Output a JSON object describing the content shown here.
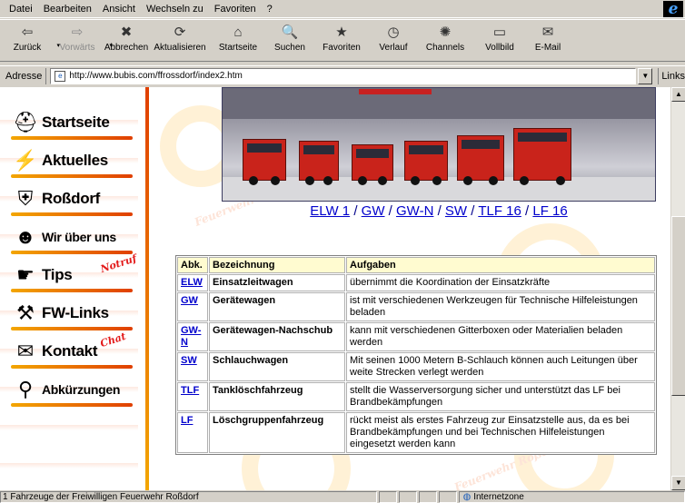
{
  "menu": [
    "Datei",
    "Bearbeiten",
    "Ansicht",
    "Wechseln zu",
    "Favoriten",
    "?"
  ],
  "toolbar": [
    {
      "label": "Zurück",
      "icon": "back-arrow-icon",
      "glyph": "⇦",
      "enabled": true,
      "dropdown": true
    },
    {
      "label": "Vorwärts",
      "icon": "forward-arrow-icon",
      "glyph": "⇨",
      "enabled": false,
      "dropdown": true
    },
    {
      "label": "Abbrechen",
      "icon": "stop-icon",
      "glyph": "✖",
      "enabled": true,
      "dropdown": false
    },
    {
      "label": "Aktualisieren",
      "icon": "refresh-icon",
      "glyph": "⟳",
      "enabled": true,
      "dropdown": false
    },
    {
      "label": "Startseite",
      "icon": "home-icon",
      "glyph": "⌂",
      "enabled": true,
      "dropdown": false
    },
    {
      "label": "Suchen",
      "icon": "search-icon",
      "glyph": "🔍",
      "enabled": true,
      "dropdown": false
    },
    {
      "label": "Favoriten",
      "icon": "favorites-icon",
      "glyph": "★",
      "enabled": true,
      "dropdown": false
    },
    {
      "label": "Verlauf",
      "icon": "history-icon",
      "glyph": "◷",
      "enabled": true,
      "dropdown": false
    },
    {
      "label": "Channels",
      "icon": "channels-icon",
      "glyph": "✺",
      "enabled": true,
      "dropdown": false
    },
    {
      "label": "Vollbild",
      "icon": "fullscreen-icon",
      "glyph": "▭",
      "enabled": true,
      "dropdown": false
    },
    {
      "label": "E-Mail",
      "icon": "mail-icon",
      "glyph": "✉",
      "enabled": true,
      "dropdown": false
    }
  ],
  "address": {
    "label": "Adresse",
    "url": "http://www.bubis.com/ffrossdorf/index2.htm",
    "links_label": "Links"
  },
  "nav": [
    {
      "label": "Startseite",
      "icon": "fire-brigade-emblem-icon",
      "glyph": "⛑",
      "badge": ""
    },
    {
      "label": "Aktuelles",
      "icon": "lightning-icon",
      "glyph": "⚡",
      "badge": ""
    },
    {
      "label": "Roßdorf",
      "icon": "coat-of-arms-icon",
      "glyph": "⛨",
      "badge": ""
    },
    {
      "label": "Wir über uns",
      "icon": "firefighters-icon",
      "glyph": "☻",
      "badge": ""
    },
    {
      "label": "Tips",
      "icon": "hand-pointing-icon",
      "glyph": "☛",
      "badge": "Notruf"
    },
    {
      "label": "FW-Links",
      "icon": "hose-nozzle-icon",
      "glyph": "⚒",
      "badge": ""
    },
    {
      "label": "Kontakt",
      "icon": "envelope-icon",
      "glyph": "✉",
      "badge": "Chat"
    },
    {
      "label": "Abkürzungen",
      "icon": "binoculars-icon",
      "glyph": "⚲",
      "badge": ""
    }
  ],
  "vehicle_links": [
    "ELW 1",
    "GW",
    "GW-N",
    "SW",
    "TLF 16",
    "LF 16"
  ],
  "table": {
    "headers": [
      "Abk.",
      "Bezeichnung",
      "Aufgaben"
    ],
    "rows": [
      {
        "abk": "ELW",
        "name": "Einsatzleitwagen",
        "task": "übernimmt die Koordination der Einsatzkräfte"
      },
      {
        "abk": "GW",
        "name": "Gerätewagen",
        "task": "ist mit verschiedenen Werkzeugen für Technische Hilfeleistungen beladen"
      },
      {
        "abk": "GW-N",
        "name": "Gerätewagen-Nachschub",
        "task": "kann mit verschiedenen Gitterboxen oder Materialien beladen werden"
      },
      {
        "abk": "SW",
        "name": "Schlauchwagen",
        "task": "Mit seinen 1000 Metern B-Schlauch können auch Leitungen über weite Strecken verlegt werden"
      },
      {
        "abk": "TLF",
        "name": "Tanklöschfahrzeug",
        "task": "stellt die Wasserversorgung sicher und unterstützt das LF bei Brandbekämpfungen"
      },
      {
        "abk": "LF",
        "name": "Löschgruppenfahrzeug",
        "task": "rückt meist als erstes Fahrzeug zur Einsatzstelle aus, da es bei Brandbekämpfungen und bei Technischen Hilfeleistungen eingesetzt werden kann"
      }
    ]
  },
  "watermark_text": "Feuerwehr Roßdorf",
  "status": {
    "text": "1 Fahrzeuge der Freiwilligen Feuerwehr Roßdorf",
    "zone": "Internetzone"
  }
}
